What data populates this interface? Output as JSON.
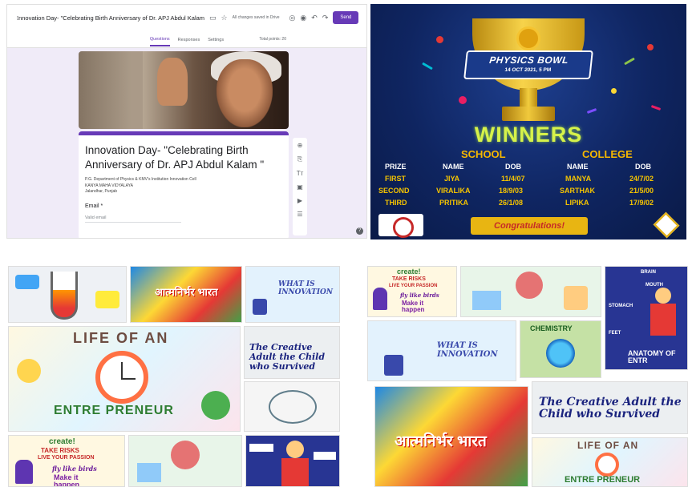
{
  "forms": {
    "title": "Innovation Day- \"Celebrating Birth Anniversary of Dr. APJ Abdul Kalam",
    "saved": "All changes saved in Drive",
    "send_label": "Send",
    "tabs": [
      "Questions",
      "Responses",
      "Settings"
    ],
    "total_points": "Total points: 20",
    "card_title": "Innovation Day- \"Celebrating Birth Anniversary of Dr. APJ Abdul Kalam \"",
    "card_sub_1": "P.G. Department of Physics & KMV's Institution Innovation Cell",
    "card_sub_2": "KANYA MAHA VIDYALAYA",
    "card_sub_3": "Jalandhar, Punjab",
    "email_label": "Email *",
    "email_placeholder": "Valid email",
    "icons": [
      "forms-logo-icon",
      "folder-icon",
      "star-icon",
      "palette-icon",
      "eye-icon",
      "undo-icon",
      "redo-icon",
      "more-icon",
      "avatar",
      "add-question-icon",
      "import-icon",
      "title-icon",
      "image-icon",
      "video-icon",
      "section-icon",
      "help-icon"
    ]
  },
  "bowl": {
    "title": "PHYSICS BOWL",
    "date": "14 OCT 2021, 5 PM",
    "winners": "WINNERS",
    "school": "SCHOOL",
    "college": "COLLEGE",
    "headers": [
      "PRIZE",
      "NAME",
      "DOB",
      "NAME",
      "DOB"
    ],
    "rows": [
      [
        "FIRST",
        "JIYA",
        "11/4/07",
        "MANYA",
        "24/7/02"
      ],
      [
        "SECOND",
        "VIRALIKA",
        "18/9/03",
        "SARTHAK",
        "21/5/00"
      ],
      [
        "THIRD",
        "PRITIKA",
        "26/1/08",
        "LIPIKA",
        "17/9/02"
      ]
    ],
    "congrats": "Congratulations!",
    "colors": {
      "background": "#0f2561",
      "gold": "#f5b700",
      "winners": "#d6f24a"
    }
  },
  "posters_left": {
    "life_title": "LIFE OF AN",
    "life_sub": "ENTRE PRENEUR",
    "atma": "आत्मनिर्भर भारत",
    "innovation": "WHAT IS INNOVATION",
    "creative": "The Creative Adult the Child who Survived",
    "create": "create!",
    "take_risks": "TAKE RISKS",
    "passion": "LIVE YOUR PASSION",
    "fly": "fly like birds",
    "make_it": "Make it happen"
  },
  "posters_right": {
    "create": "create!",
    "take_risks": "TAKE RISKS",
    "passion": "LIVE YOUR PASSION",
    "fly": "fly like birds",
    "make_it": "Make it happen",
    "innovation": "WHAT IS INNOVATION",
    "chemistry": "CHEMISTRY",
    "anatomy": "ANATOMY OF ENTR",
    "brain": "BRAIN",
    "mouth": "MOUTH",
    "stomach": "STOMACH",
    "feet": "FEET",
    "creative": "The Creative Adult the Child who Survived",
    "atma": "आत्मनिर्भर भारत",
    "life_title": "LIFE OF AN",
    "life_sub": "ENTRE PRENEUR"
  }
}
